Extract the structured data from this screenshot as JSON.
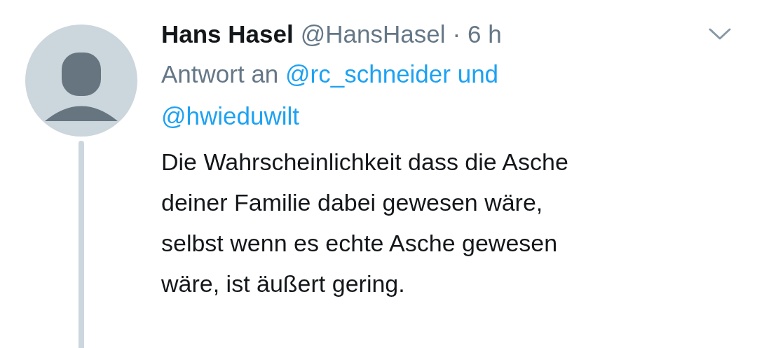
{
  "tweet": {
    "author_name": "Hans Hasel",
    "handle": "@HansHasel",
    "separator": "·",
    "time": "6 h",
    "reply_prefix": "Antwort an",
    "reply_to_lines": [
      "@rc_schneider und",
      "@hwieduwilt"
    ],
    "body_lines": [
      "Die Wahrscheinlichkeit dass die Asche",
      "deiner Familie dabei gewesen wäre,",
      "selbst wenn es echte Asche gewesen",
      "wäre, ist äußert gering."
    ],
    "thread_continues": true
  }
}
